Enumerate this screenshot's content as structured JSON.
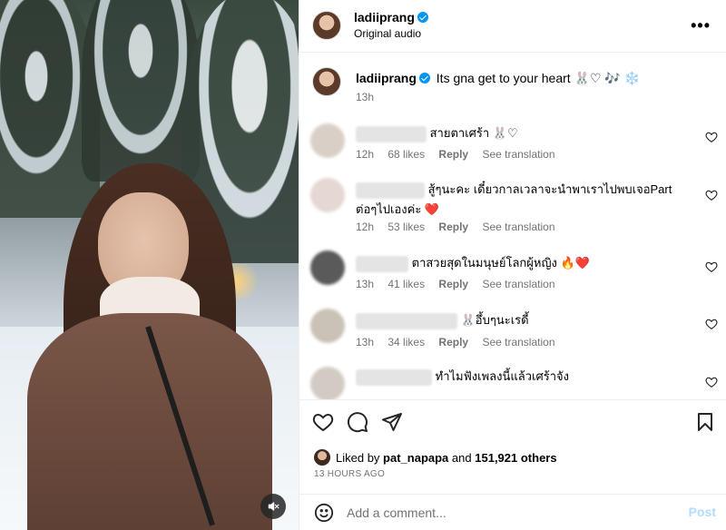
{
  "header": {
    "username": "ladiiprang",
    "audio": "Original audio"
  },
  "caption": {
    "username": "ladiiprang",
    "text": "Its gna get to your heart 🐰♡ 🎶 ❄️",
    "time": "13h"
  },
  "comments": [
    {
      "text": "สายตาเศร้า 🐰♡",
      "time": "12h",
      "likes": "68 likes",
      "reply": "Reply",
      "translation": "See translation"
    },
    {
      "text": "สู้ๆนะคะ เดี๋ยวกาลเวลาจะนำพาเราไปพบเจอPart ต่อๆไปเองค่ะ ❤️",
      "time": "12h",
      "likes": "53 likes",
      "reply": "Reply",
      "translation": "See translation"
    },
    {
      "text": "ตาสวยสุดในมนุษย์โลกผู้หญิง 🔥❤️",
      "time": "13h",
      "likes": "41 likes",
      "reply": "Reply",
      "translation": "See translation"
    },
    {
      "text": "🐰อึ้บๆนะเรดี้",
      "time": "13h",
      "likes": "34 likes",
      "reply": "Reply",
      "translation": "See translation"
    },
    {
      "text": "ทำไมฟังเพลงนี้แล้วเศร้าจัง",
      "time": "",
      "likes": "",
      "reply": "",
      "translation": ""
    }
  ],
  "likes": {
    "prefix": "Liked by",
    "user": "pat_napapa",
    "joiner": "and",
    "others": "151,921 others"
  },
  "time_ago": "13 HOURS AGO",
  "comment_box": {
    "placeholder": "Add a comment...",
    "post_label": "Post"
  },
  "icons": {
    "more": "more-options-icon",
    "mute": "muted-speaker-icon",
    "like": "heart-icon",
    "comment": "comment-icon",
    "share": "share-icon",
    "save": "bookmark-icon",
    "emoji": "emoji-icon"
  },
  "colors": {
    "accent": "#0095f6",
    "post_disabled": "#b3dbff",
    "muted_text": "#737373",
    "divider": "#efefef"
  }
}
